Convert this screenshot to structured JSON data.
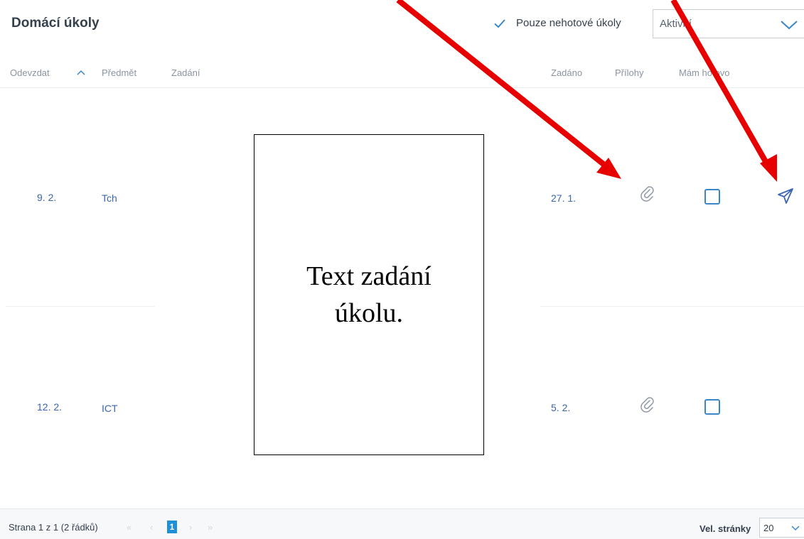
{
  "header": {
    "title": "Domácí úkoly",
    "filter_label": "Pouze nehotové úkoly",
    "status_select_value": "Aktivní"
  },
  "table": {
    "columns": [
      "Odevzdat",
      "Předmět",
      "Zadání",
      "Zadáno",
      "Přílohy",
      "Mám hotovo"
    ],
    "rows": [
      {
        "due": "9. 2.",
        "subject": "Tch",
        "assigned": "27. 1.",
        "has_attachment": true,
        "done": false,
        "has_send": true
      },
      {
        "due": "12. 2.",
        "subject": "ICT",
        "assigned": "5. 2.",
        "has_attachment": true,
        "done": false,
        "has_send": false
      }
    ]
  },
  "overlay": {
    "text": "Text zadání úkolu."
  },
  "footer": {
    "page_info": "Strana 1 z 1 (2 řádků)",
    "first": "«",
    "prev": "‹",
    "current_page": "1",
    "next": "›",
    "last": "»",
    "page_size_label": "Vel. stránky",
    "page_size_value": "20"
  },
  "colors": {
    "accent": "#1e8fd8",
    "link": "#3a66b0",
    "annotation_arrow": "#e60000"
  },
  "icons": [
    "check-icon",
    "chevron-down-icon",
    "sort-up-icon",
    "paperclip-icon",
    "send-icon"
  ]
}
